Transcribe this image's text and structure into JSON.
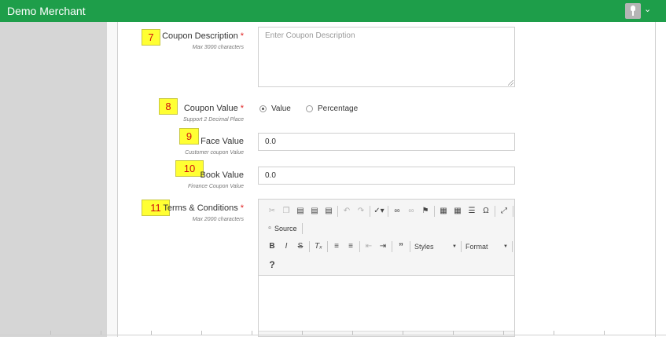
{
  "header": {
    "title": "Demo Merchant"
  },
  "badges": [
    "7",
    "8",
    "9",
    "10",
    "11"
  ],
  "coupon_description": {
    "label": "Coupon Description",
    "required_mark": "*",
    "hint": "Max 3000 characters",
    "placeholder": "Enter Coupon Description"
  },
  "coupon_value": {
    "label": "Coupon Value",
    "required_mark": "*",
    "hint": "Support 2 Decimal Place",
    "options": [
      "Value",
      "Percentage"
    ],
    "selected": "Value"
  },
  "face_value": {
    "label": "Face Value",
    "hint": "Customer coupon Value",
    "value": "0.0"
  },
  "book_value": {
    "label": "Book Value",
    "hint": "Finance Coupon Value",
    "value": "0.0"
  },
  "terms": {
    "label": "Terms & Conditions",
    "required_mark": "*",
    "hint": "Max 2000 characters",
    "source_label": "Source",
    "styles_label": "Styles",
    "format_label": "Format",
    "toolbar_row1_icons": [
      "cut-icon",
      "copy-icon",
      "paste-icon",
      "paste-text-icon",
      "paste-word-icon",
      "undo-icon",
      "redo-icon",
      "spellcheck-icon",
      "link-icon",
      "unlink-icon",
      "anchor-icon",
      "image-icon",
      "table-icon",
      "horizontal-line-icon",
      "special-char-icon",
      "maximize-icon"
    ],
    "toolbar_row3_icons": [
      "bold-icon",
      "italic-icon",
      "strike-icon",
      "remove-format-icon",
      "numbered-list-icon",
      "bulleted-list-icon",
      "outdent-icon",
      "indent-icon",
      "blockquote-icon"
    ],
    "help_label": "?"
  }
}
